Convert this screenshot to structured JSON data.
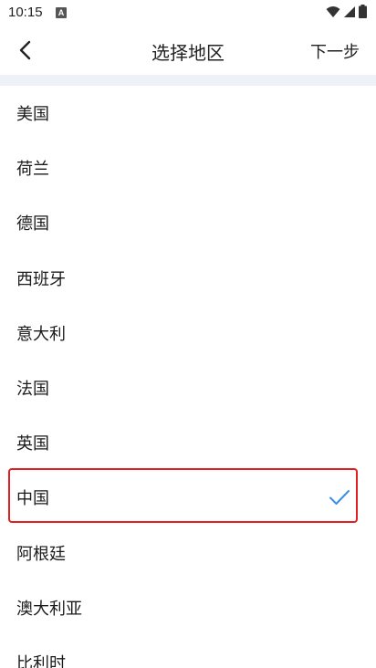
{
  "status_bar": {
    "time": "10:15",
    "notification_icon": "a-icon",
    "icons": [
      "wifi-icon",
      "signal-icon",
      "battery-icon"
    ]
  },
  "header": {
    "back_icon": "chevron-left-icon",
    "title": "选择地区",
    "next_label": "下一步"
  },
  "regions": {
    "items": [
      {
        "label": "美国",
        "selected": false
      },
      {
        "label": "荷兰",
        "selected": false
      },
      {
        "label": "德国",
        "selected": false
      },
      {
        "label": "西班牙",
        "selected": false
      },
      {
        "label": "意大利",
        "selected": false
      },
      {
        "label": "法国",
        "selected": false
      },
      {
        "label": "英国",
        "selected": false
      },
      {
        "label": "中国",
        "selected": true
      },
      {
        "label": "阿根廷",
        "selected": false
      },
      {
        "label": "澳大利亚",
        "selected": false
      },
      {
        "label": "比利时",
        "selected": false
      }
    ]
  },
  "colors": {
    "accent": "#3a8ee6",
    "highlight_border": "#e02020",
    "divider": "#eef2f8"
  }
}
